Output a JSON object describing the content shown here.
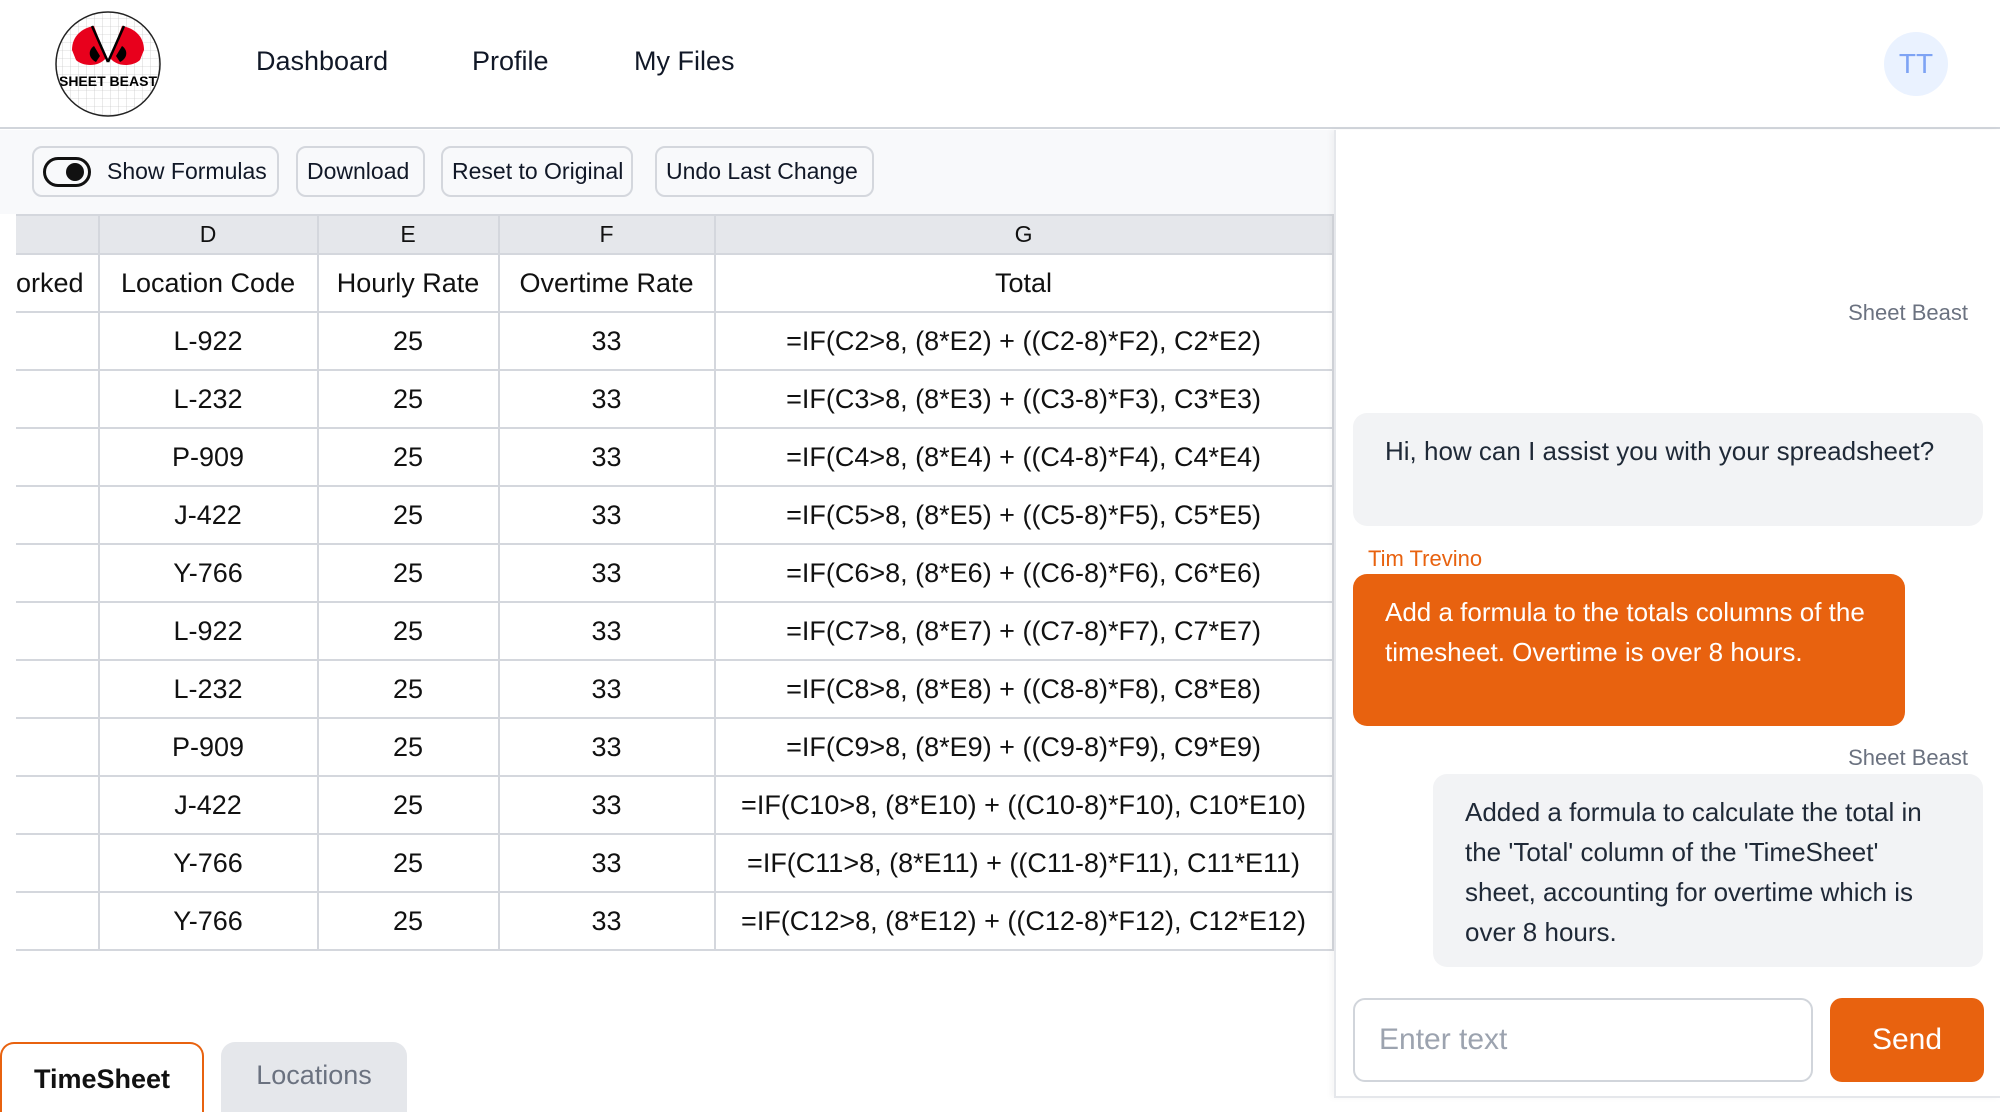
{
  "header": {
    "logo_text": "SHEET BEAST",
    "nav": [
      {
        "label": "Dashboard"
      },
      {
        "label": "Profile"
      },
      {
        "label": "My Files"
      }
    ],
    "avatar_initials": "TT"
  },
  "toolbar": {
    "show_formulas_label": "Show Formulas",
    "show_formulas_on": true,
    "download_label": "Download",
    "reset_label": "Reset to Original",
    "undo_label": "Undo Last Change"
  },
  "sheet": {
    "column_letters": [
      "",
      "D",
      "E",
      "F",
      "G"
    ],
    "column_names": [
      "orked",
      "Location Code",
      "Hourly Rate",
      "Overtime Rate",
      "Total"
    ],
    "rows": [
      {
        "c": "",
        "d": "L-922",
        "e": "25",
        "f": "33",
        "g": "=IF(C2>8, (8*E2) + ((C2-8)*F2), C2*E2)"
      },
      {
        "c": "",
        "d": "L-232",
        "e": "25",
        "f": "33",
        "g": "=IF(C3>8, (8*E3) + ((C3-8)*F3), C3*E3)"
      },
      {
        "c": "",
        "d": "P-909",
        "e": "25",
        "f": "33",
        "g": "=IF(C4>8, (8*E4) + ((C4-8)*F4), C4*E4)"
      },
      {
        "c": "",
        "d": "J-422",
        "e": "25",
        "f": "33",
        "g": "=IF(C5>8, (8*E5) + ((C5-8)*F5), C5*E5)"
      },
      {
        "c": "",
        "d": "Y-766",
        "e": "25",
        "f": "33",
        "g": "=IF(C6>8, (8*E6) + ((C6-8)*F6), C6*E6)"
      },
      {
        "c": "",
        "d": "L-922",
        "e": "25",
        "f": "33",
        "g": "=IF(C7>8, (8*E7) + ((C7-8)*F7), C7*E7)"
      },
      {
        "c": "",
        "d": "L-232",
        "e": "25",
        "f": "33",
        "g": "=IF(C8>8, (8*E8) + ((C8-8)*F8), C8*E8)"
      },
      {
        "c": "",
        "d": "P-909",
        "e": "25",
        "f": "33",
        "g": "=IF(C9>8, (8*E9) + ((C9-8)*F9), C9*E9)"
      },
      {
        "c": "",
        "d": "J-422",
        "e": "25",
        "f": "33",
        "g": "=IF(C10>8, (8*E10) + ((C10-8)*F10), C10*E10)"
      },
      {
        "c": "",
        "d": "Y-766",
        "e": "25",
        "f": "33",
        "g": "=IF(C11>8, (8*E11) + ((C11-8)*F11), C11*E11)"
      },
      {
        "c": "",
        "d": "Y-766",
        "e": "25",
        "f": "33",
        "g": "=IF(C12>8, (8*E12) + ((C12-8)*F12), C12*E12)"
      }
    ]
  },
  "tabs": [
    {
      "label": "TimeSheet",
      "active": true
    },
    {
      "label": "Locations",
      "active": false
    }
  ],
  "chat": {
    "messages": [
      {
        "sender": "Sheet Beast",
        "role": "bot",
        "text": "Hi, how can I assist you with your spreadsheet?"
      },
      {
        "sender": "Tim Trevino",
        "role": "user",
        "text": "Add a formula to the totals columns of the timesheet. Overtime is over 8 hours."
      },
      {
        "sender": "Sheet Beast",
        "role": "bot",
        "text": "Added a formula to calculate the total in the 'Total' column of the 'TimeSheet' sheet, accounting for overtime which is over 8 hours."
      }
    ],
    "input_value": "",
    "input_placeholder": "Enter text",
    "send_label": "Send"
  },
  "colors": {
    "accent": "#e8620f",
    "avatar_bg": "#eaf2ff",
    "avatar_text": "#7ea3f4",
    "logo_red": "#e8001c"
  }
}
